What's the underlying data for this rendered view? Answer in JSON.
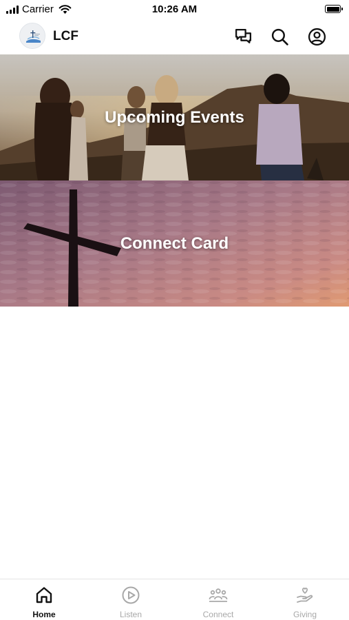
{
  "status_bar": {
    "carrier": "Carrier",
    "time": "10:26 AM"
  },
  "header": {
    "title": "LCF",
    "logo_icon": "church-logo",
    "actions": [
      {
        "icon": "chat-icon"
      },
      {
        "icon": "search-icon"
      },
      {
        "icon": "account-icon"
      }
    ]
  },
  "cards": [
    {
      "label": "Upcoming Events",
      "image": "women-at-sunset-photo"
    },
    {
      "label": "Connect Card",
      "image": "cross-at-dusk-photo"
    }
  ],
  "tab_bar": {
    "active_tab": "Home",
    "active_color": "#111111",
    "inactive_color": "#a8a8a8",
    "tabs": [
      {
        "label": "Home",
        "icon": "home-icon"
      },
      {
        "label": "Listen",
        "icon": "play-circle-icon"
      },
      {
        "label": "Connect",
        "icon": "group-icon"
      },
      {
        "label": "Giving",
        "icon": "giving-hand-icon"
      }
    ]
  }
}
